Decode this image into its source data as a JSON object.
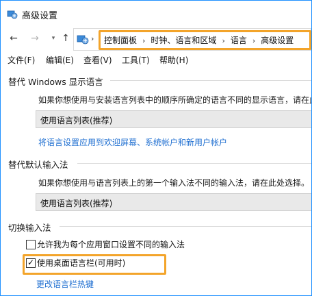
{
  "window": {
    "title": "高级设置"
  },
  "navigation": {
    "breadcrumbs": [
      "控制面板",
      "时钟、语言和区域",
      "语言",
      "高级设置"
    ],
    "highlight_color": "#f3a42a"
  },
  "menu": [
    "文件(F)",
    "编辑(E)",
    "查看(V)",
    "工具(T)",
    "帮助(H)"
  ],
  "display_language": {
    "title": "替代 Windows 显示语言",
    "description": "如果你想使用与安装语言列表中的顺序所确定的语言不同的显示语言，请在此",
    "selected": "使用语言列表(推荐)",
    "link": "将语言设置应用到欢迎屏幕、系统帐户和新用户帐户"
  },
  "input_method": {
    "title": "替代默认输入法",
    "description": "如果你想使用与语言列表上的第一个输入法不同的输入法，请在此处选择。",
    "selected": "使用语言列表(推荐)"
  },
  "switch_input": {
    "title": "切换输入法",
    "options": [
      {
        "label": "允许我为每个应用窗口设置不同的输入法",
        "checked": false
      },
      {
        "label": "使用桌面语言栏(可用时)",
        "checked": true
      }
    ],
    "link": "更改语言栏热键"
  }
}
